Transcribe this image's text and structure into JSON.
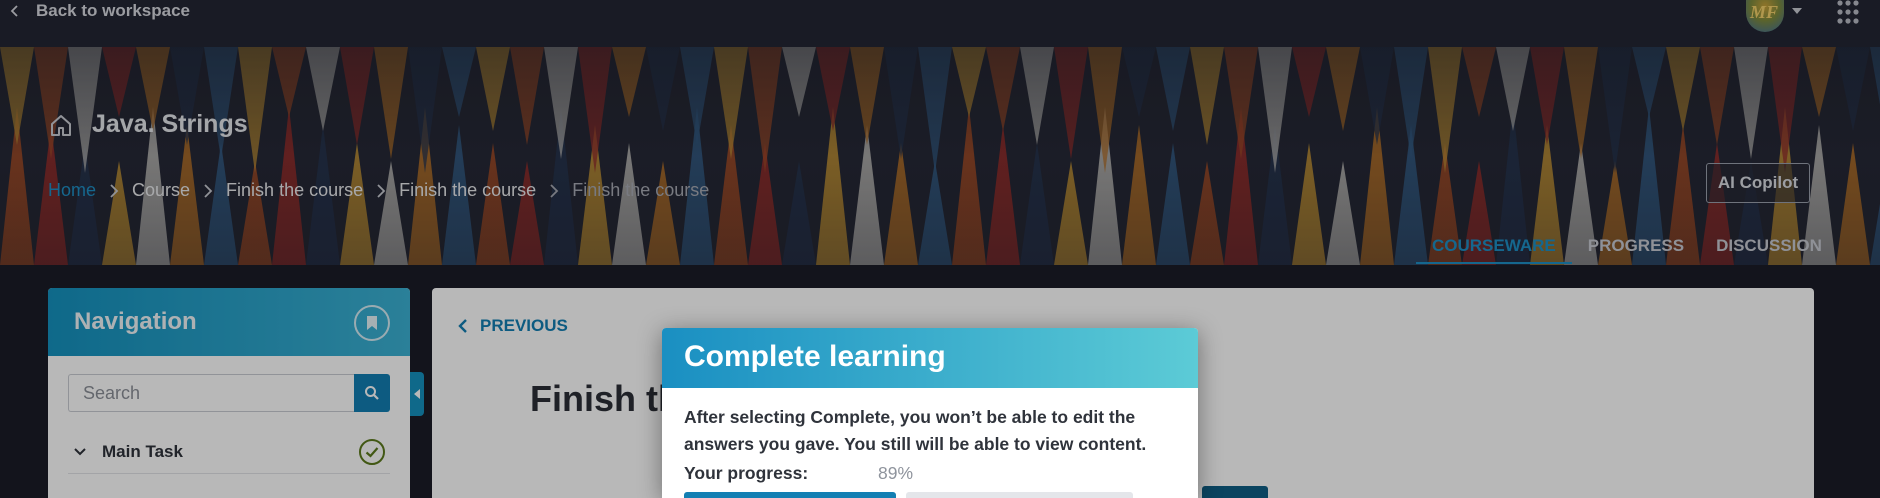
{
  "topbar": {
    "back_label": "Back to workspace",
    "avatar_initials": "MF"
  },
  "course": {
    "title": "Java. Strings"
  },
  "breadcrumb": [
    {
      "label": "Home",
      "type": "home"
    },
    {
      "label": "Course",
      "type": "link"
    },
    {
      "label": "Finish the course",
      "type": "link"
    },
    {
      "label": "Finish the course",
      "type": "link"
    },
    {
      "label": "Finish the course",
      "type": "current"
    }
  ],
  "ai_copilot_label": "AI Copilot",
  "tabs": [
    {
      "label": "COURSEWARE",
      "active": true
    },
    {
      "label": "PROGRESS",
      "active": false
    },
    {
      "label": "DISCUSSION",
      "active": false
    }
  ],
  "navigation": {
    "title": "Navigation",
    "search_placeholder": "Search",
    "items": [
      {
        "label": "Main Task",
        "completed": true
      }
    ]
  },
  "content": {
    "previous_label": "PREVIOUS",
    "title": "Finish the course"
  },
  "modal": {
    "title": "Complete learning",
    "message": "After selecting Complete, you won’t be able to edit the answers you gave. You still will be able to view content.",
    "progress_label": "Your progress:",
    "progress_value": "89%",
    "progress_fraction": 0.89
  },
  "colors": {
    "accent": "#1e8fc5",
    "header_bg": "#232634",
    "success": "#5c7a1d"
  }
}
